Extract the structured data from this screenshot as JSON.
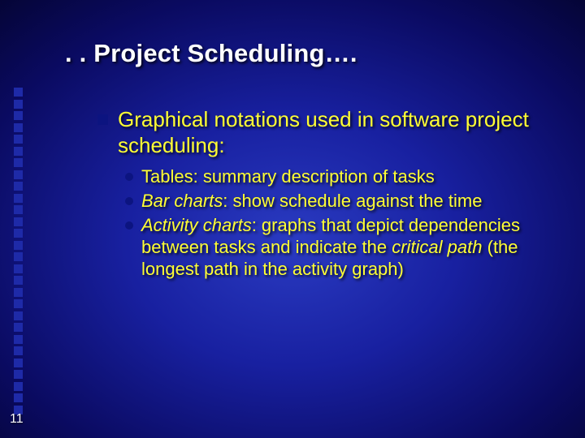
{
  "title": ". . Project Scheduling….",
  "main_bullet": "Graphical notations used in software project scheduling:",
  "sub1_plain": "Tables: summary description of tasks",
  "sub2_em": "Bar charts",
  "sub2_rest": ": show schedule against the time",
  "sub3_em": "Activity charts",
  "sub3_mid": ": graphs that depict dependencies between tasks and indicate the ",
  "sub3_em2": "critical path",
  "sub3_tail": " (the longest path in the activity graph)",
  "page_number": "11"
}
